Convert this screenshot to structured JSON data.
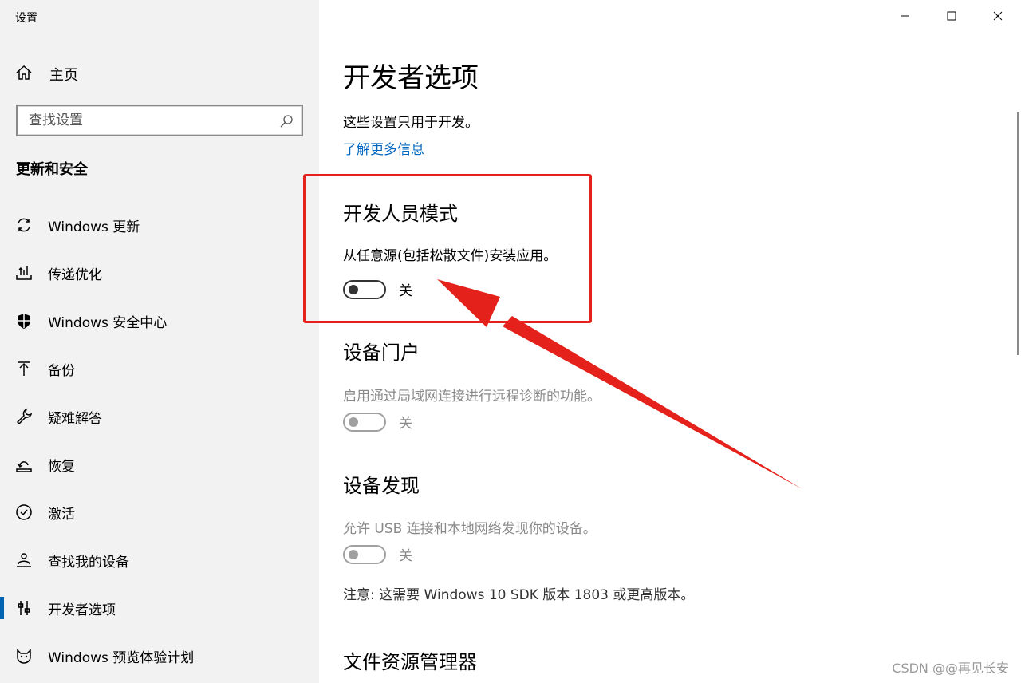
{
  "window": {
    "title": "设置"
  },
  "sidebar": {
    "home_label": "主页",
    "search_placeholder": "查找设置",
    "section_title": "更新和安全",
    "items": [
      {
        "label": "Windows 更新",
        "icon": "refresh-icon"
      },
      {
        "label": "传递优化",
        "icon": "delivery-icon"
      },
      {
        "label": "Windows 安全中心",
        "icon": "shield-icon"
      },
      {
        "label": "备份",
        "icon": "backup-arrow-icon"
      },
      {
        "label": "疑难解答",
        "icon": "wrench-icon"
      },
      {
        "label": "恢复",
        "icon": "recovery-icon"
      },
      {
        "label": "激活",
        "icon": "check-circle-icon"
      },
      {
        "label": "查找我的设备",
        "icon": "person-location-icon"
      },
      {
        "label": "开发者选项",
        "icon": "developer-tools-icon",
        "active": true
      },
      {
        "label": "Windows 预览体验计划",
        "icon": "cat-icon"
      }
    ]
  },
  "main": {
    "title": "开发者选项",
    "description": "这些设置只用于开发。",
    "learn_more": "了解更多信息",
    "developer_mode": {
      "title": "开发人员模式",
      "description": "从任意源(包括松散文件)安装应用。",
      "toggle_label": "关"
    },
    "device_portal": {
      "title": "设备门户",
      "description": "启用通过局域网连接进行远程诊断的功能。",
      "toggle_label": "关"
    },
    "device_discovery": {
      "title": "设备发现",
      "description": "允许 USB 连接和本地网络发现你的设备。",
      "toggle_label": "关",
      "note": "注意: 这需要 Windows 10 SDK 版本 1803 或更高版本。"
    },
    "file_explorer": {
      "title": "文件资源管理器"
    }
  },
  "colors": {
    "accent": "#0063b1",
    "link": "#0067c0",
    "annotation": "#e5211b"
  },
  "watermark": "CSDN @@再见长安"
}
